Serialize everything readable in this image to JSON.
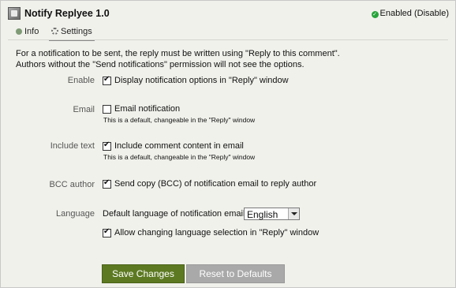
{
  "header": {
    "title": "Notify Replyee 1.0",
    "status_text": "Enabled (",
    "status_link": "Disable",
    "status_close": ")"
  },
  "tabs": [
    {
      "label": "Info"
    },
    {
      "label": "Settings"
    }
  ],
  "intro": {
    "line1": "For a notification to be sent, the reply must be written using \"Reply to this comment\".",
    "line2": "Authors without the \"Send notifications\" permission will not see the options."
  },
  "settings": {
    "enable": {
      "label": "Enable",
      "checkbox": "Display notification options in \"Reply\" window",
      "checked": true
    },
    "email": {
      "label": "Email",
      "checkbox": "Email notification",
      "checked": false,
      "hint": "This is a default, changeable in the \"Reply\" window"
    },
    "include_text": {
      "label": "Include text",
      "checkbox": "Include comment content in email",
      "checked": true,
      "hint": "This is a default, changeable in the \"Reply\" window"
    },
    "bcc": {
      "label": "BCC author",
      "checkbox": "Send copy (BCC) of notification email to reply author",
      "checked": true
    },
    "language": {
      "label": "Language",
      "select_label": "Default language of notification email:",
      "select_value": "English",
      "checkbox": "Allow changing language selection in \"Reply\" window",
      "checked": true
    }
  },
  "buttons": {
    "save": "Save Changes",
    "reset": "Reset to Defaults"
  }
}
